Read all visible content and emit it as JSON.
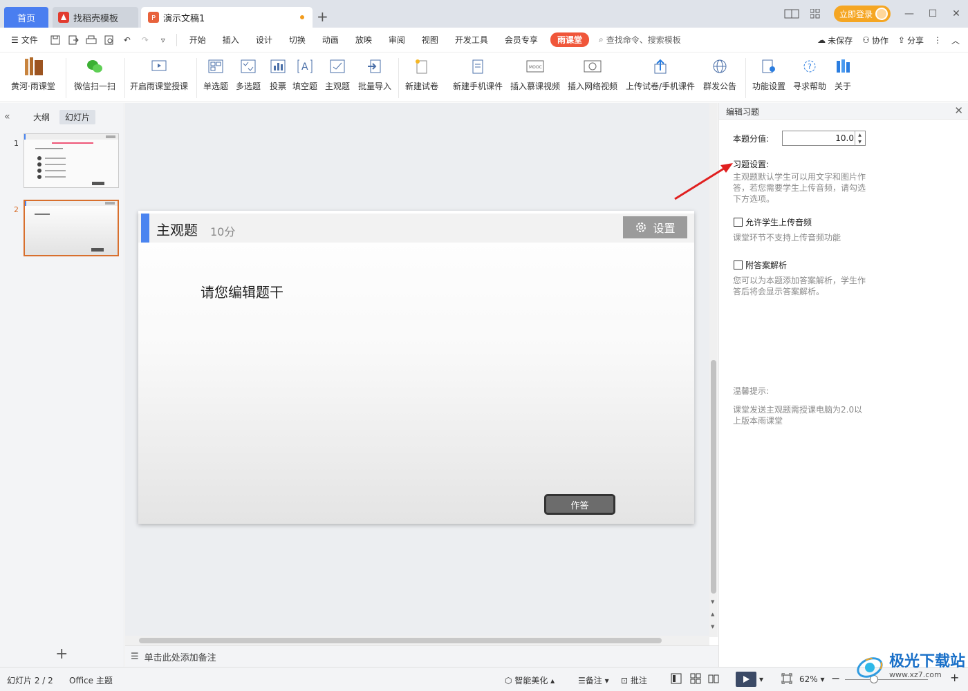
{
  "tabs": {
    "home": "首页",
    "shell_templates": "找稻壳模板",
    "document": "演示文稿1",
    "add": "+"
  },
  "titlebar": {
    "login": "立即登录"
  },
  "menu": {
    "file": "文件",
    "items": [
      "开始",
      "插入",
      "设计",
      "切换",
      "动画",
      "放映",
      "审阅",
      "视图",
      "开发工具",
      "会员专享"
    ],
    "yuketang": "雨课堂",
    "search_placeholder": "查找命令、搜索模板",
    "unsaved": "未保存",
    "collaborate": "协作",
    "share": "分享"
  },
  "ribbon": {
    "brand": "黄河·雨课堂",
    "wechat_scan": "微信扫一扫",
    "start_class": "开启雨课堂授课",
    "single_choice": "单选题",
    "multiple_choice": "多选题",
    "vote": "投票",
    "fill_blank": "填空题",
    "subjective": "主观题",
    "batch_import": "批量导入",
    "new_exam": "新建试卷",
    "new_mobile": "新建手机课件",
    "insert_mooc": "插入慕课视频",
    "insert_web_video": "插入网络视频",
    "upload": "上传试卷/手机课件",
    "announce": "群发公告",
    "settings": "功能设置",
    "help": "寻求帮助",
    "about": "关于"
  },
  "left_panel": {
    "outline": "大纲",
    "slides": "幻灯片",
    "thumbnails": [
      {
        "number": "1"
      },
      {
        "number": "2"
      }
    ]
  },
  "slide": {
    "title": "主观题",
    "score": "10分",
    "settings": "设置",
    "stem": "请您编辑题干",
    "answer": "作答"
  },
  "notes": {
    "placeholder": "单击此处添加备注"
  },
  "right_panel": {
    "title": "编辑习题",
    "score_label": "本题分值:",
    "score_value": "10.0",
    "exercise_settings": "习题设置:",
    "exercise_desc": "主观题默认学生可以用文字和图片作答，若您需要学生上传音频，请勾选下方选项。",
    "allow_audio": "允许学生上传音频",
    "allow_audio_note": "课堂环节不支持上传音频功能",
    "attach_analysis": "附答案解析",
    "attach_analysis_note": "您可以为本题添加答案解析，学生作答后将会显示答案解析。",
    "tip_title": "温馨提示:",
    "tip_text": "课堂发送主观题需授课电脑为2.0以上版本雨课堂"
  },
  "status": {
    "slide_counter": "幻灯片 2 / 2",
    "theme": "Office 主题",
    "smart_beautify": "智能美化",
    "notes": "备注",
    "comments": "批注",
    "zoom": "62%"
  },
  "watermark": {
    "text": "极光下载站",
    "url": "www.xz7.com"
  },
  "colors": {
    "accent": "#4a7ef0",
    "yuketang": "#f0563a",
    "slide_bar": "#4a84f0",
    "annotation_arrow": "#e02020"
  }
}
